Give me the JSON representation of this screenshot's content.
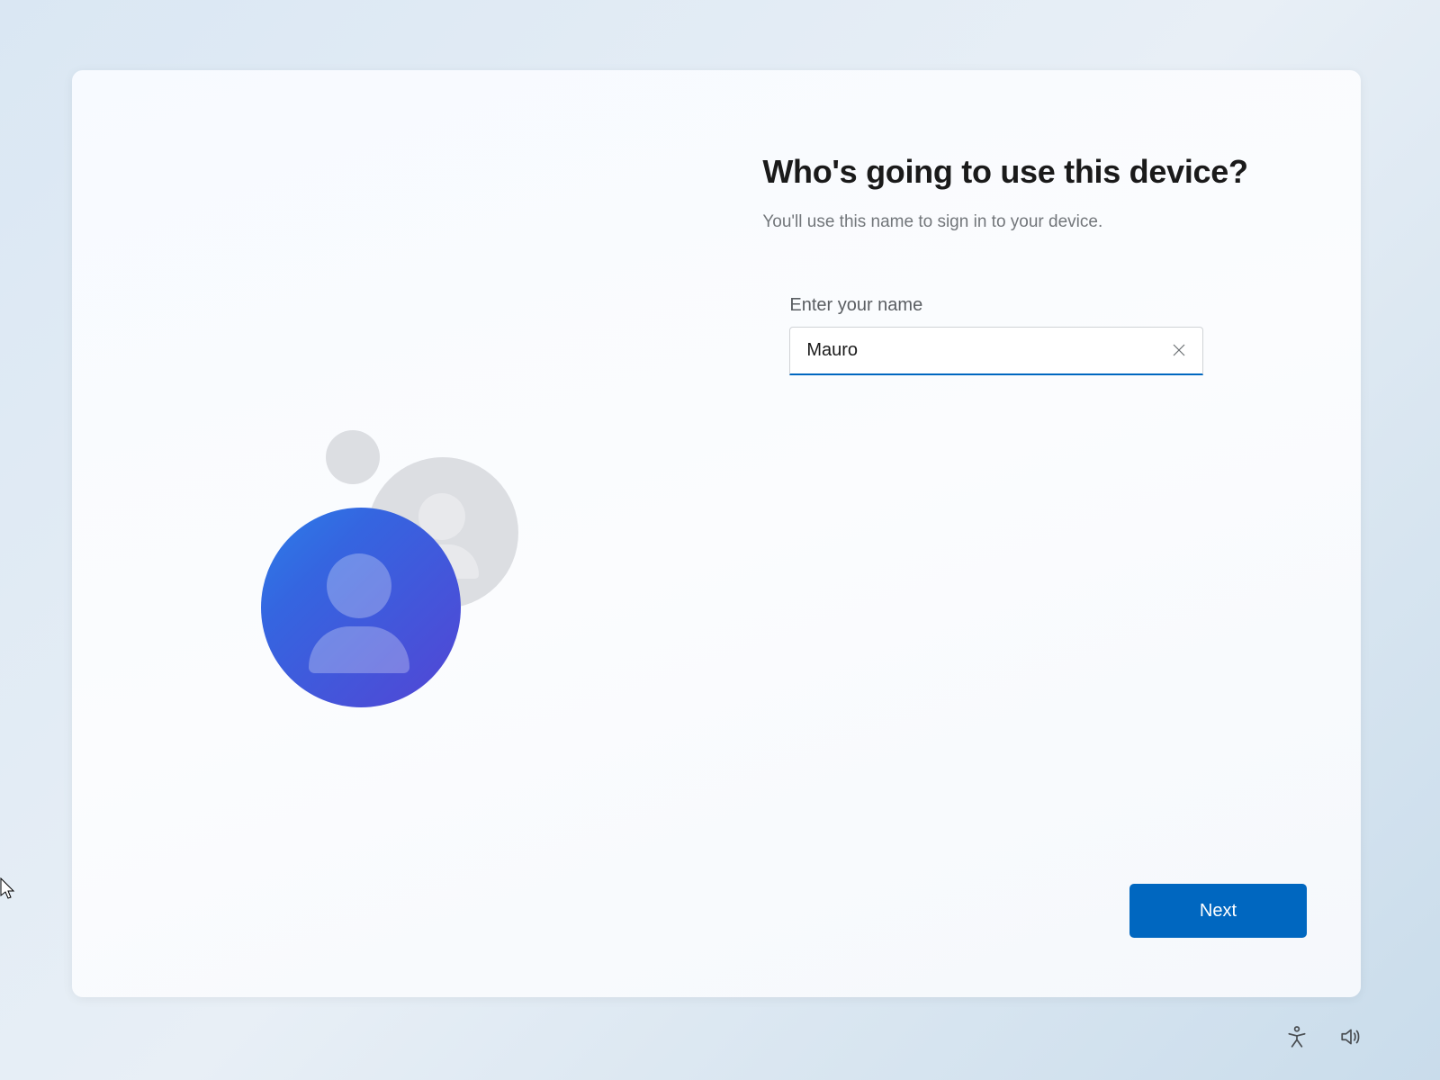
{
  "main": {
    "heading": "Who's going to use this device?",
    "subtitle": "You'll use this name to sign in to your device.",
    "input": {
      "label": "Enter your name",
      "value": "Mauro"
    },
    "next_button": "Next"
  },
  "colors": {
    "accent": "#0067c0",
    "blue_gradient_start": "#2c7de8",
    "blue_gradient_end": "#5345d4"
  }
}
